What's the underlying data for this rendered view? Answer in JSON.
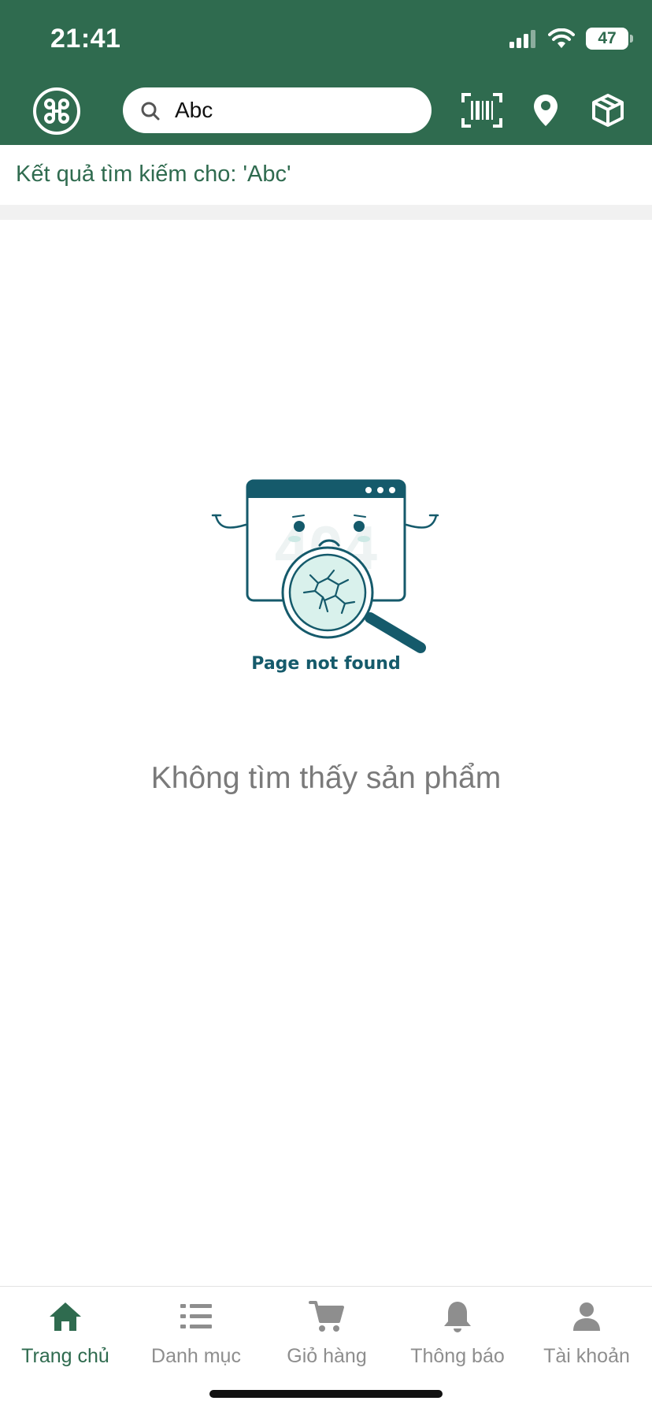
{
  "status_bar": {
    "time": "21:41",
    "battery": "47"
  },
  "search": {
    "value": "Abc"
  },
  "results": {
    "label": "Kết quả tìm kiếm cho: 'Abc'"
  },
  "empty_state": {
    "illustration_caption": "Page not found",
    "illustration_bg_text": "404",
    "message": "Không tìm thấy sản phẩm"
  },
  "tabs": [
    {
      "label": "Trang chủ",
      "icon": "home-icon",
      "active": true
    },
    {
      "label": "Danh mục",
      "icon": "list-icon",
      "active": false
    },
    {
      "label": "Giỏ hàng",
      "icon": "cart-icon",
      "active": false
    },
    {
      "label": "Thông báo",
      "icon": "bell-icon",
      "active": false
    },
    {
      "label": "Tài khoản",
      "icon": "user-icon",
      "active": false
    }
  ],
  "colors": {
    "brand": "#2f6b4f",
    "illustration": "#155a6b",
    "muted": "#8e8e8e"
  }
}
